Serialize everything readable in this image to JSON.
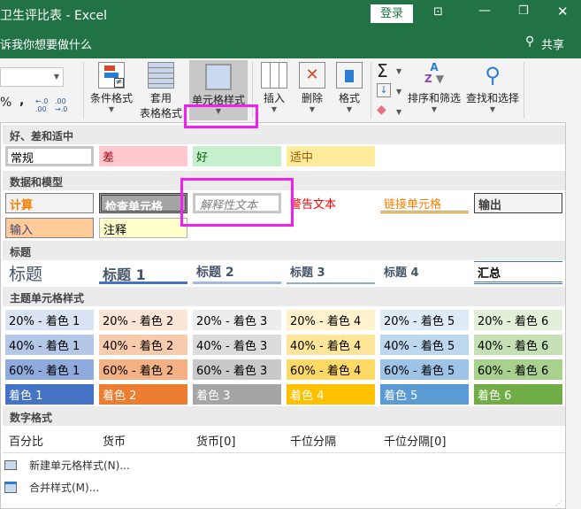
{
  "titlebar": {
    "title": "卫生评比表 - Excel",
    "login": "登录"
  },
  "tellme": {
    "text": "诉我你想要做什么",
    "share": "共享"
  },
  "ribbon": {
    "number": {
      "percent": "%",
      "comma": ",",
      "inc": "←.0 .00",
      "dec": ".00 →.0"
    },
    "buttons": [
      {
        "label": "条件格式",
        "label2": ""
      },
      {
        "label": "套用",
        "label2": "表格格式"
      },
      {
        "label": "单元格样式",
        "label2": ""
      },
      {
        "label": "插入",
        "label2": ""
      },
      {
        "label": "删除",
        "label2": ""
      },
      {
        "label": "格式",
        "label2": ""
      },
      {
        "label": "排序和筛选",
        "label2": ""
      },
      {
        "label": "查找和选择",
        "label2": ""
      }
    ]
  },
  "sections": {
    "good_bad": "好、差和适中",
    "data_model": "数据和模型",
    "titles": "标题",
    "theme": "主题单元格样式",
    "number": "数字格式"
  },
  "good_bad": [
    {
      "label": "常规",
      "bg": "#ffffff",
      "fg": "#000000"
    },
    {
      "label": "差",
      "bg": "#ffc7ce",
      "fg": "#9c0006"
    },
    {
      "label": "好",
      "bg": "#c6efce",
      "fg": "#006100"
    },
    {
      "label": "适中",
      "bg": "#ffeb9c",
      "fg": "#9c5700"
    }
  ],
  "data_model": [
    {
      "label": "计算",
      "bg": "#f2f2f2",
      "fg": "#fa7d00"
    },
    {
      "label": "检查单元格",
      "bg": "#a5a5a5",
      "fg": "#ffffff"
    },
    {
      "label": "解释性文本",
      "bg": "#ffffff",
      "fg": "#7f7f7f"
    },
    {
      "label": "警告文本",
      "bg": "#ffffff",
      "fg": "#ff0000"
    },
    {
      "label": "链接单元格",
      "bg": "#ffffff",
      "fg": "#fa7d00"
    },
    {
      "label": "输出",
      "bg": "#f2f2f2",
      "fg": "#3f3f3f"
    },
    {
      "label": "输入",
      "bg": "#ffcc99",
      "fg": "#3f3f76"
    },
    {
      "label": "注释",
      "bg": "#ffffcc",
      "fg": "#000000"
    }
  ],
  "titles": [
    "标题",
    "标题 1",
    "标题 2",
    "标题 3",
    "标题 4",
    "汇总"
  ],
  "theme": {
    "rows": [
      {
        "prefix": "20% - 着色 ",
        "bgs": [
          "#dae3f3",
          "#fbe5d6",
          "#ededed",
          "#fff2cc",
          "#deebf7",
          "#e2f0d9"
        ],
        "fg": "#000000"
      },
      {
        "prefix": "40% - 着色 ",
        "bgs": [
          "#b4c7e7",
          "#f8cbad",
          "#dbdbdb",
          "#ffe699",
          "#bdd7ee",
          "#c5e0b4"
        ],
        "fg": "#000000"
      },
      {
        "prefix": "60% - 着色 ",
        "bgs": [
          "#8faadc",
          "#f4b183",
          "#c9c9c9",
          "#ffd966",
          "#9dc3e6",
          "#a9d18e"
        ],
        "fg": "#000000"
      },
      {
        "prefix": "着色 ",
        "bgs": [
          "#4472c4",
          "#ed7d31",
          "#a5a5a5",
          "#ffc000",
          "#5b9bd5",
          "#70ad47"
        ],
        "fg": "#ffffff"
      }
    ],
    "labels": [
      [
        "20% - 着色 1",
        "20% - 着色 2",
        "20% - 着色 3",
        "20% - 着色 4",
        "20% - 着色 5",
        "20% - 着色 6"
      ],
      [
        "40% - 着色 1",
        "40% - 着色 2",
        "40% - 着色 3",
        "40% - 着色 4",
        "40% - 着色 5",
        "40% - 着色 6"
      ],
      [
        "60% - 着色 1",
        "60% - 着色 2",
        "60% - 着色 3",
        "60% - 着色 4",
        "60% - 着色 5",
        "60% - 着色 6"
      ],
      [
        "着色 1",
        "着色 2",
        "着色 3",
        "着色 4",
        "着色 5",
        "着色 6"
      ]
    ]
  },
  "number_formats": [
    "百分比",
    "货币",
    "货币[0]",
    "千位分隔",
    "千位分隔[0]"
  ],
  "menu": {
    "new_style": "新建单元格样式(N)...",
    "merge_styles": "合并样式(M)..."
  },
  "colors": {
    "excel_green": "#217346",
    "highlight": "#f020f0"
  }
}
